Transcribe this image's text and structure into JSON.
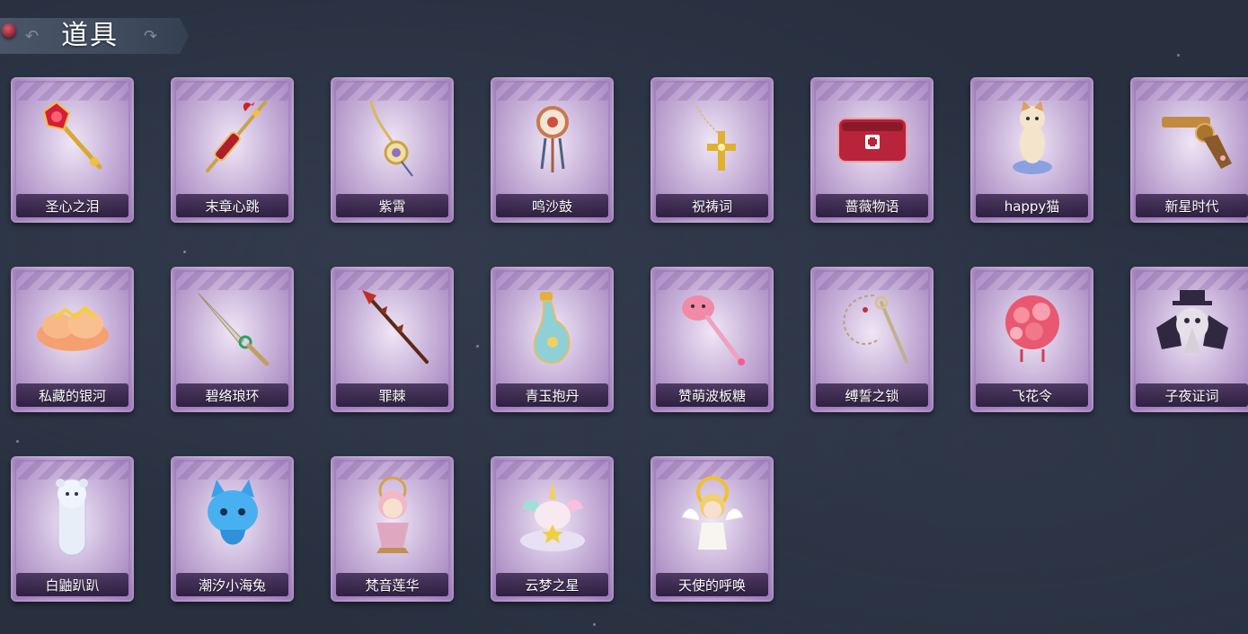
{
  "header": {
    "title": "道具"
  },
  "items": [
    {
      "name": "圣心之泪",
      "icon": "scepter-ruby-icon",
      "color": "#d21e3c"
    },
    {
      "name": "末章心跳",
      "icon": "syringe-scepter-icon",
      "color": "#b01e2e"
    },
    {
      "name": "紫霄",
      "icon": "pendant-charm-icon",
      "color": "#c9a24a"
    },
    {
      "name": "鸣沙鼓",
      "icon": "dreamcatcher-drum-icon",
      "color": "#c87850"
    },
    {
      "name": "祝祷词",
      "icon": "cross-rosary-icon",
      "color": "#e0b030"
    },
    {
      "name": "蔷薇物语",
      "icon": "first-aid-kit-icon",
      "color": "#b8243a"
    },
    {
      "name": "happy猫",
      "icon": "cat-figure-icon",
      "color": "#f0c890"
    },
    {
      "name": "新星时代",
      "icon": "revolver-icon",
      "color": "#c08a40"
    },
    {
      "name": "私藏的银河",
      "icon": "golden-cloud-icon",
      "color": "#f5a070"
    },
    {
      "name": "碧络琅环",
      "icon": "jade-dagger-icon",
      "color": "#c0a060"
    },
    {
      "name": "罪棘",
      "icon": "thorn-spear-icon",
      "color": "#8a3020"
    },
    {
      "name": "青玉抱丹",
      "icon": "jade-vase-icon",
      "color": "#8ed0d8"
    },
    {
      "name": "赞萌波板糖",
      "icon": "pink-wand-icon",
      "color": "#f08aa8"
    },
    {
      "name": "缚誓之锁",
      "icon": "chain-key-icon",
      "color": "#c0a080"
    },
    {
      "name": "飞花令",
      "icon": "flower-lantern-icon",
      "color": "#e85870"
    },
    {
      "name": "子夜证词",
      "icon": "plague-doctor-icon",
      "color": "#302840"
    },
    {
      "name": "白鼬趴趴",
      "icon": "white-ferret-icon",
      "color": "#e8eef8"
    },
    {
      "name": "潮汐小海兔",
      "icon": "blue-sea-bunny-icon",
      "color": "#3aa0e8"
    },
    {
      "name": "梵音莲华",
      "icon": "lotus-doll-icon",
      "color": "#f0b8c8"
    },
    {
      "name": "云梦之星",
      "icon": "unicorn-cloud-icon",
      "color": "#f0a8d0"
    },
    {
      "name": "天使的呼唤",
      "icon": "angel-doll-icon",
      "color": "#f0d070"
    }
  ]
}
